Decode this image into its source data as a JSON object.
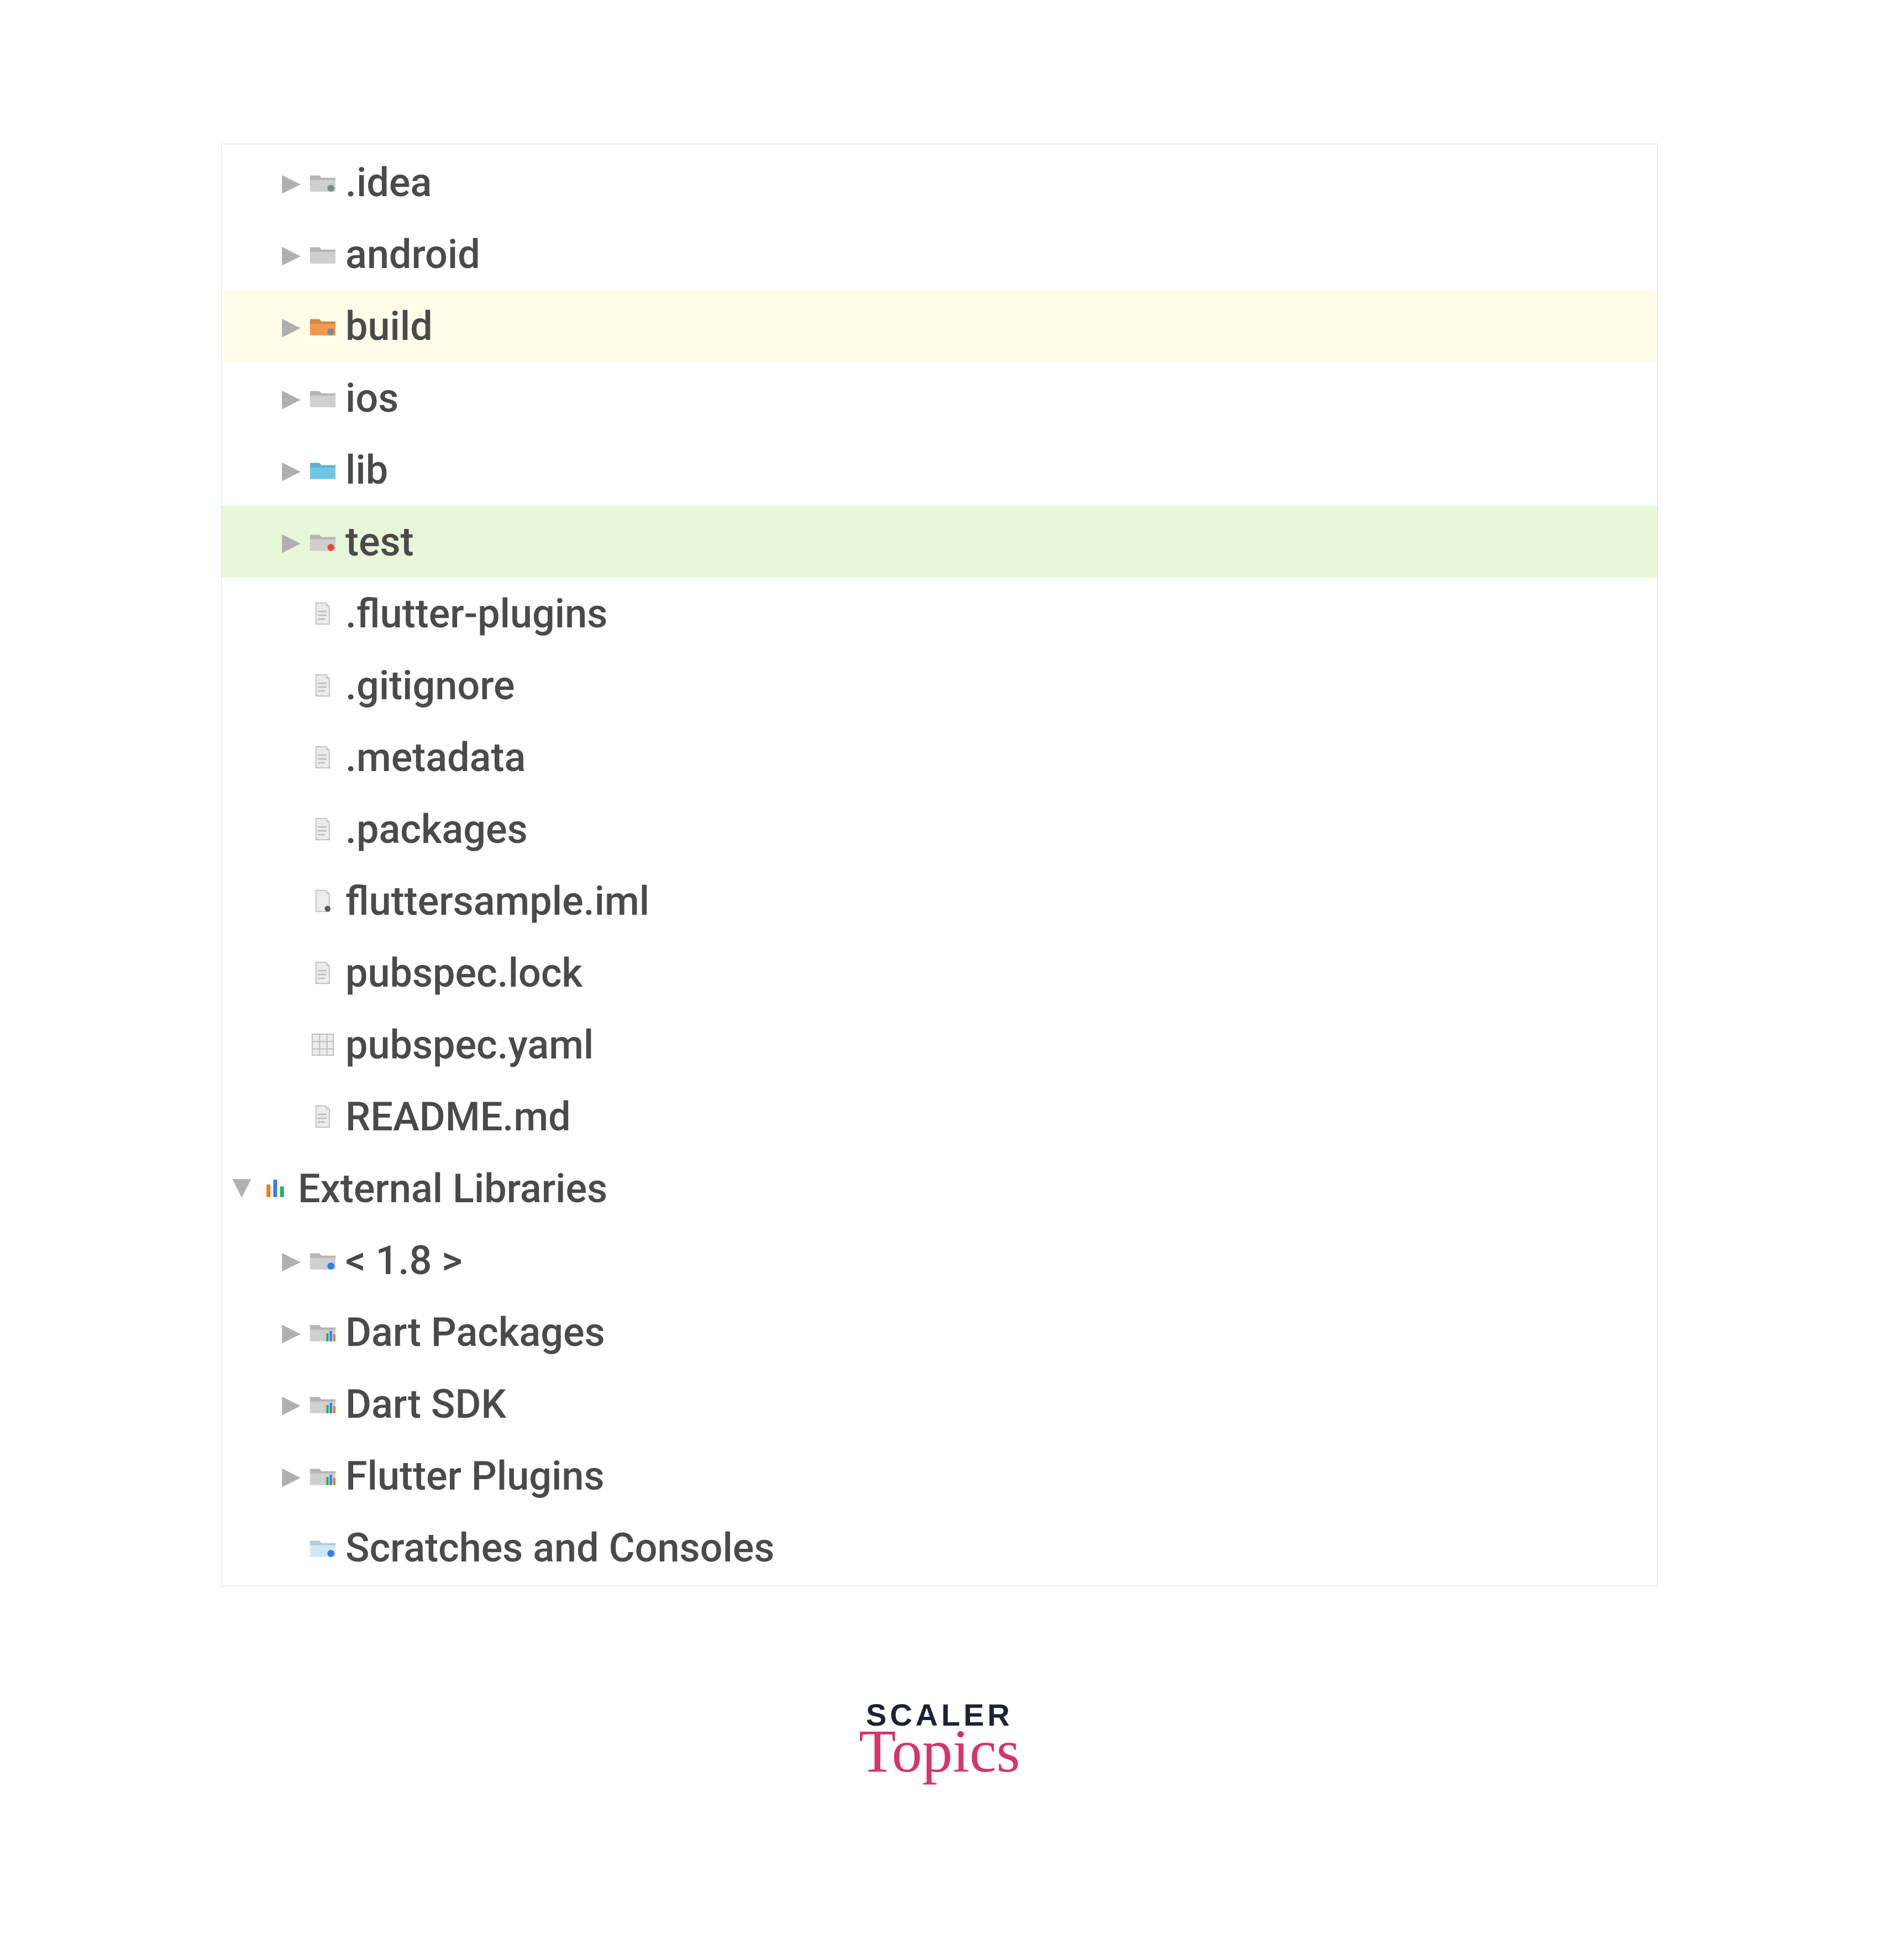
{
  "tree": [
    {
      "label": ".idea",
      "icon": "folder-cog",
      "arrow": "right",
      "indent": 1,
      "hl": ""
    },
    {
      "label": "android",
      "icon": "folder-gray",
      "arrow": "right",
      "indent": 1,
      "hl": ""
    },
    {
      "label": "build",
      "icon": "folder-orange",
      "arrow": "right",
      "indent": 1,
      "hl": "yellow"
    },
    {
      "label": "ios",
      "icon": "folder-gray",
      "arrow": "right",
      "indent": 1,
      "hl": ""
    },
    {
      "label": "lib",
      "icon": "folder-blue",
      "arrow": "right",
      "indent": 1,
      "hl": ""
    },
    {
      "label": "test",
      "icon": "folder-dot",
      "arrow": "right",
      "indent": 1,
      "hl": "green"
    },
    {
      "label": ".flutter-plugins",
      "icon": "file",
      "arrow": "",
      "indent": 1,
      "hl": ""
    },
    {
      "label": ".gitignore",
      "icon": "file",
      "arrow": "",
      "indent": 1,
      "hl": ""
    },
    {
      "label": ".metadata",
      "icon": "file",
      "arrow": "",
      "indent": 1,
      "hl": ""
    },
    {
      "label": ".packages",
      "icon": "file",
      "arrow": "",
      "indent": 1,
      "hl": ""
    },
    {
      "label": "fluttersample.iml",
      "icon": "file-dot",
      "arrow": "",
      "indent": 1,
      "hl": ""
    },
    {
      "label": "pubspec.lock",
      "icon": "file",
      "arrow": "",
      "indent": 1,
      "hl": ""
    },
    {
      "label": "pubspec.yaml",
      "icon": "file-grid",
      "arrow": "",
      "indent": 1,
      "hl": ""
    },
    {
      "label": "README.md",
      "icon": "file",
      "arrow": "",
      "indent": 1,
      "hl": ""
    },
    {
      "label": "External Libraries",
      "icon": "lib-bars",
      "arrow": "down",
      "indent": 0,
      "hl": ""
    },
    {
      "label": "< 1.8 >",
      "icon": "folder-java",
      "arrow": "right",
      "indent": 1,
      "hl": ""
    },
    {
      "label": "Dart Packages",
      "icon": "lib-folder",
      "arrow": "right",
      "indent": 1,
      "hl": ""
    },
    {
      "label": "Dart SDK",
      "icon": "lib-folder",
      "arrow": "right",
      "indent": 1,
      "hl": ""
    },
    {
      "label": "Flutter Plugins",
      "icon": "lib-folder",
      "arrow": "right",
      "indent": 1,
      "hl": ""
    },
    {
      "label": "Scratches and Consoles",
      "icon": "folder-blue-dot",
      "arrow": "",
      "indent": 1,
      "hl": ""
    }
  ],
  "brand": {
    "line1": "SCALER",
    "line2": "Topics"
  }
}
